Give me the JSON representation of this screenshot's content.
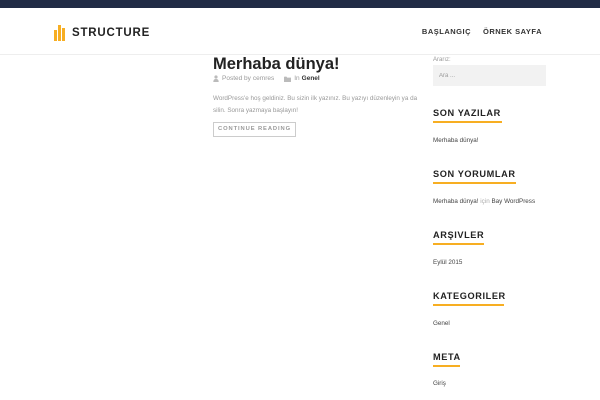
{
  "site": {
    "logo_text": "STRUCTURE",
    "accent_color": "#f7ae22",
    "topbar_color": "#212b45"
  },
  "nav": {
    "items": [
      "BAŞLANGIÇ",
      "ÖRNEK SAYFA"
    ]
  },
  "post": {
    "title": "Merhaba dünya!",
    "meta_posted_by": "Posted by",
    "meta_author": "cemres",
    "meta_in": "In",
    "meta_category": "Genel",
    "excerpt": "WordPress'e hoş geldiniz. Bu sizin ilk yazınız. Bu yazıyı düzenleyin ya da silin. Sonra yazmaya başlayın!",
    "button_label": "CONTINUE READING"
  },
  "sidebar": {
    "search_label": "Ararız:",
    "search_placeholder": "Ara ...",
    "widgets": {
      "recent_posts": {
        "title": "SON YAZILAR",
        "item": "Merhaba dünya!"
      },
      "recent_comments": {
        "title": "SON YORUMLAR",
        "link": "Merhaba dünya!",
        "connector": "için",
        "author": "Bay WordPress"
      },
      "archives": {
        "title": "ARŞIVLER",
        "item": "Eylül 2015"
      },
      "categories": {
        "title": "KATEGORILER",
        "item": "Genel"
      },
      "meta": {
        "title": "META",
        "item": "Giriş"
      }
    }
  }
}
